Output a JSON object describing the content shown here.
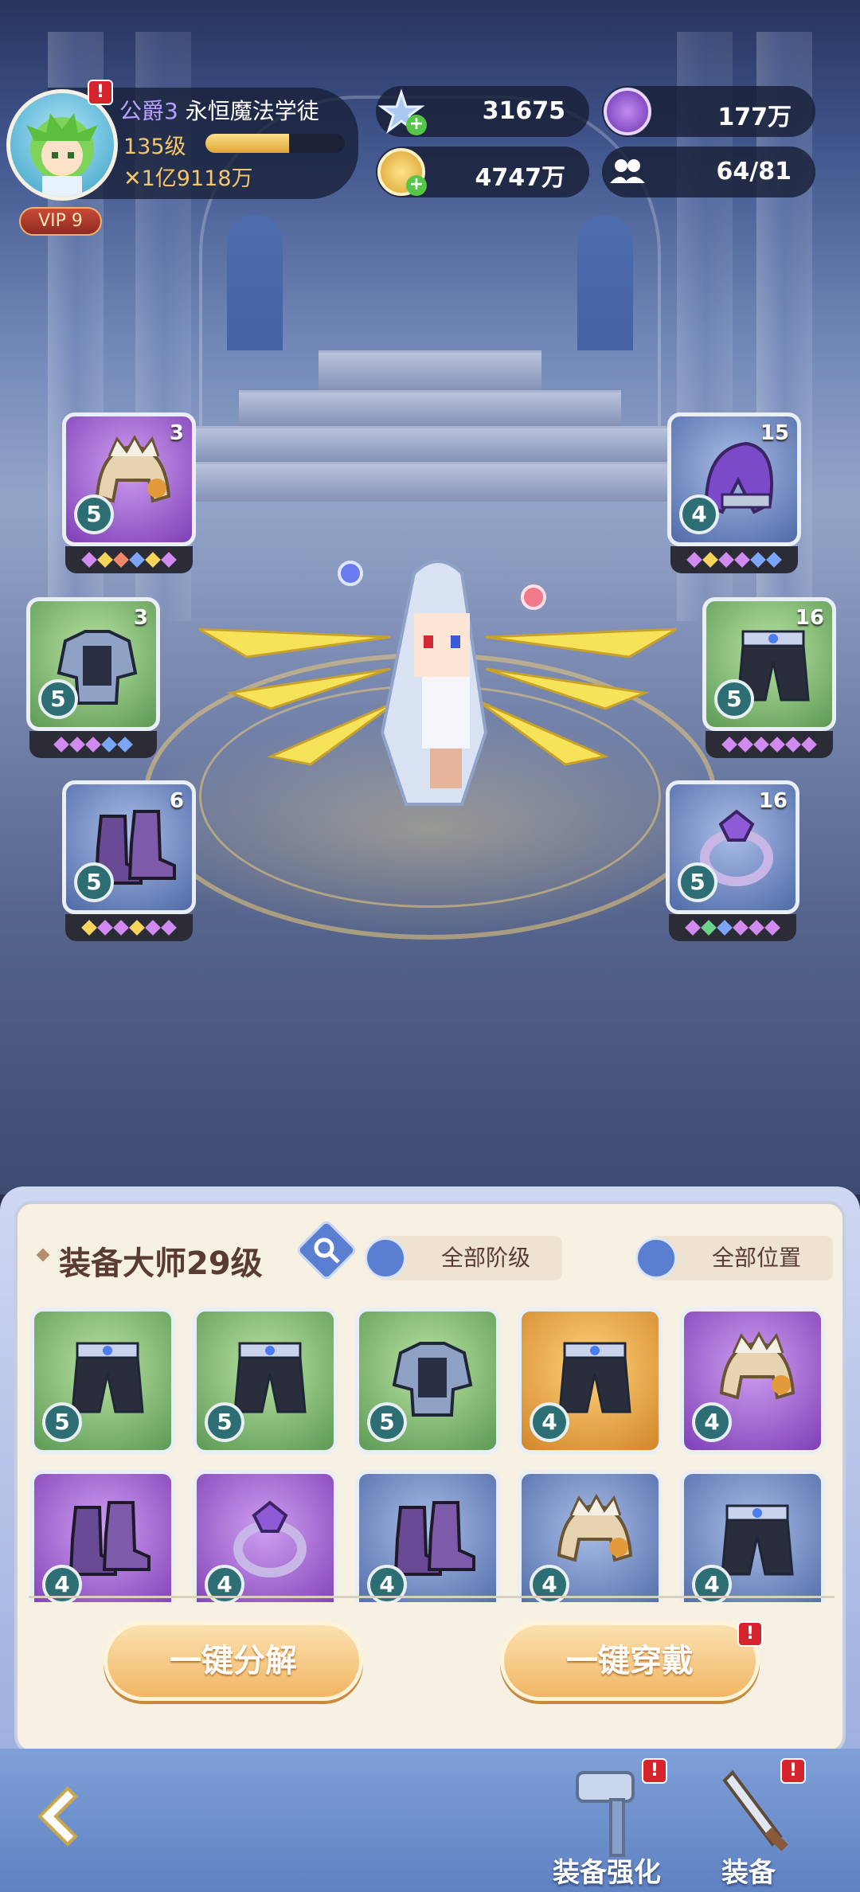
{
  "player": {
    "title_rank": "公爵3",
    "title_name": "永恒魔法学徒",
    "level": "135级",
    "exp_fraction": 0.6,
    "power": "1亿9118万",
    "vip": "VIP 9",
    "avatar_alert": "!"
  },
  "resources": {
    "stars": "31675",
    "purple_currency": "177万",
    "gold": "4747万",
    "members": "64/81"
  },
  "equipped": {
    "left": [
      {
        "name": "helmet",
        "tier": "5",
        "count": "3",
        "gems": [
          "#d18bf0",
          "#f7d45a",
          "#f0876a",
          "#7aa6f5",
          "#f7d45a",
          "#d18bf0"
        ],
        "rarity": "purple"
      },
      {
        "name": "armor",
        "tier": "5",
        "count": "3",
        "gems": [
          "#d18bf0",
          "#d18bf0",
          "#d18bf0",
          "#7aa6f5",
          "#7aa6f5"
        ],
        "rarity": "green"
      },
      {
        "name": "boots",
        "tier": "5",
        "count": "6",
        "gems": [
          "#f7d45a",
          "#d18bf0",
          "#d18bf0",
          "#f7d45a",
          "#d18bf0",
          "#d18bf0"
        ],
        "rarity": "blue"
      }
    ],
    "right": [
      {
        "name": "hood",
        "tier": "4",
        "count": "15",
        "gems": [
          "#d18bf0",
          "#f7d45a",
          "#d18bf0",
          "#d18bf0",
          "#7aa6f5",
          "#7aa6f5"
        ],
        "rarity": "blue"
      },
      {
        "name": "pants",
        "tier": "5",
        "count": "16",
        "gems": [
          "#d18bf0",
          "#d18bf0",
          "#d18bf0",
          "#d18bf0",
          "#d18bf0",
          "#d18bf0"
        ],
        "rarity": "green"
      },
      {
        "name": "ring",
        "tier": "5",
        "count": "16",
        "gems": [
          "#d18bf0",
          "#6ed38a",
          "#7aa6f5",
          "#d18bf0",
          "#d18bf0",
          "#d18bf0"
        ],
        "rarity": "blue"
      }
    ]
  },
  "panel": {
    "title": "装备大师29级",
    "filter_tier": "全部阶级",
    "filter_slot": "全部位置",
    "items": [
      {
        "type": "pants",
        "tier": "5",
        "rarity": "green"
      },
      {
        "type": "pants",
        "tier": "5",
        "rarity": "green"
      },
      {
        "type": "armor",
        "tier": "5",
        "rarity": "green"
      },
      {
        "type": "pants",
        "tier": "4",
        "rarity": "orange"
      },
      {
        "type": "helmet",
        "tier": "4",
        "rarity": "purple"
      },
      {
        "type": "boots",
        "tier": "4",
        "rarity": "purple"
      },
      {
        "type": "ring",
        "tier": "4",
        "rarity": "purple"
      },
      {
        "type": "boots",
        "tier": "4",
        "rarity": "blue"
      },
      {
        "type": "helmet",
        "tier": "4",
        "rarity": "blue"
      },
      {
        "type": "pants",
        "tier": "4",
        "rarity": "blue"
      }
    ],
    "decompose_label": "一键分解",
    "equip_all_label": "一键穿戴",
    "equip_all_alert": "!"
  },
  "nav": {
    "enhance_label": "装备强化",
    "enhance_alert": "!",
    "equip_label": "装备",
    "equip_alert": "!"
  }
}
